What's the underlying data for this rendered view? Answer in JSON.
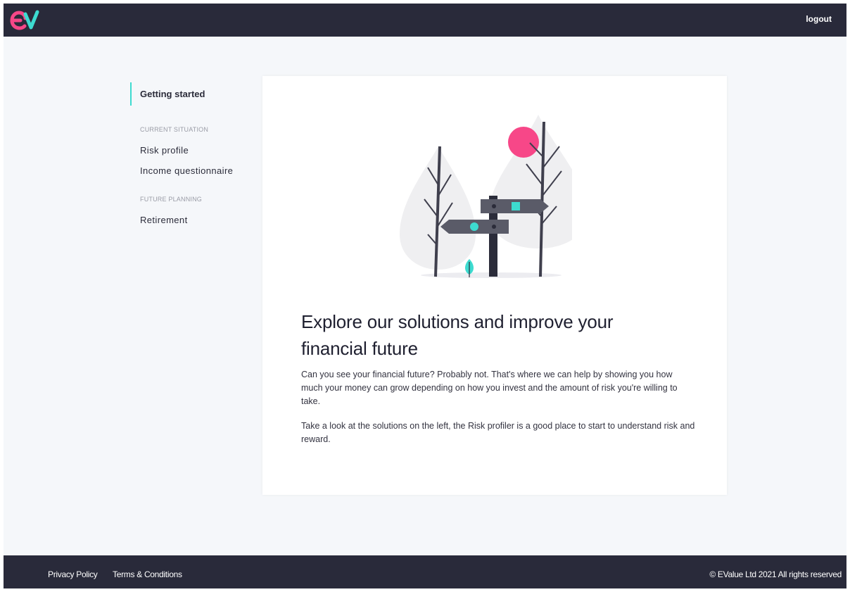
{
  "header": {
    "logo_text": "ev",
    "logout_label": "logout"
  },
  "sidebar": {
    "active_item": "Getting started",
    "sections": [
      {
        "title": "CURRENT SITUATION",
        "items": [
          "Risk profile",
          "Income questionnaire"
        ]
      },
      {
        "title": "FUTURE PLANNING",
        "items": [
          "Retirement"
        ]
      }
    ]
  },
  "content": {
    "headline": "Explore our solutions and improve your financial future",
    "paragraph_1": "Can you see your financial future? Probably not. That's where we can help by showing you how much your money can grow depending on how you invest and the amount of risk you're willing to take.",
    "paragraph_2": "Take a look at the solutions on the left, the Risk profiler is a good place to start to understand risk and reward."
  },
  "footer": {
    "links": [
      "Privacy Policy",
      "Terms & Conditions"
    ],
    "copyright": "© EValue Ltd 2021 All rights reserved"
  },
  "colors": {
    "header_bg": "#292a3a",
    "accent_teal": "#3ddbd0",
    "accent_pink": "#f74788",
    "page_bg": "#f5f7fa"
  }
}
